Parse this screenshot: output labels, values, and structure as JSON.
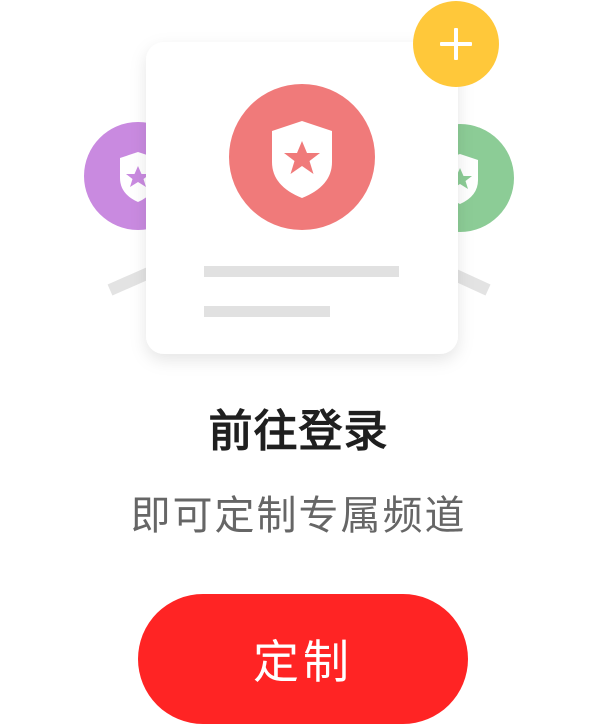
{
  "login_prompt": {
    "title": "前往登录",
    "subtitle": "即可定制专属频道",
    "button_label": "定制"
  },
  "icons": {
    "card_badge": "shield-star-icon",
    "left_badge": "shield-star-icon",
    "right_badge": "shield-star-icon",
    "add_badge": "plus-icon"
  },
  "colors": {
    "accent": "#ff2424",
    "card_badge": "#f07a7a",
    "left_badge": "#c98ae0",
    "right_badge": "#8ccc96",
    "add_badge": "#ffc83a",
    "title_text": "#1f1f1f",
    "subtitle_text": "#666666"
  }
}
